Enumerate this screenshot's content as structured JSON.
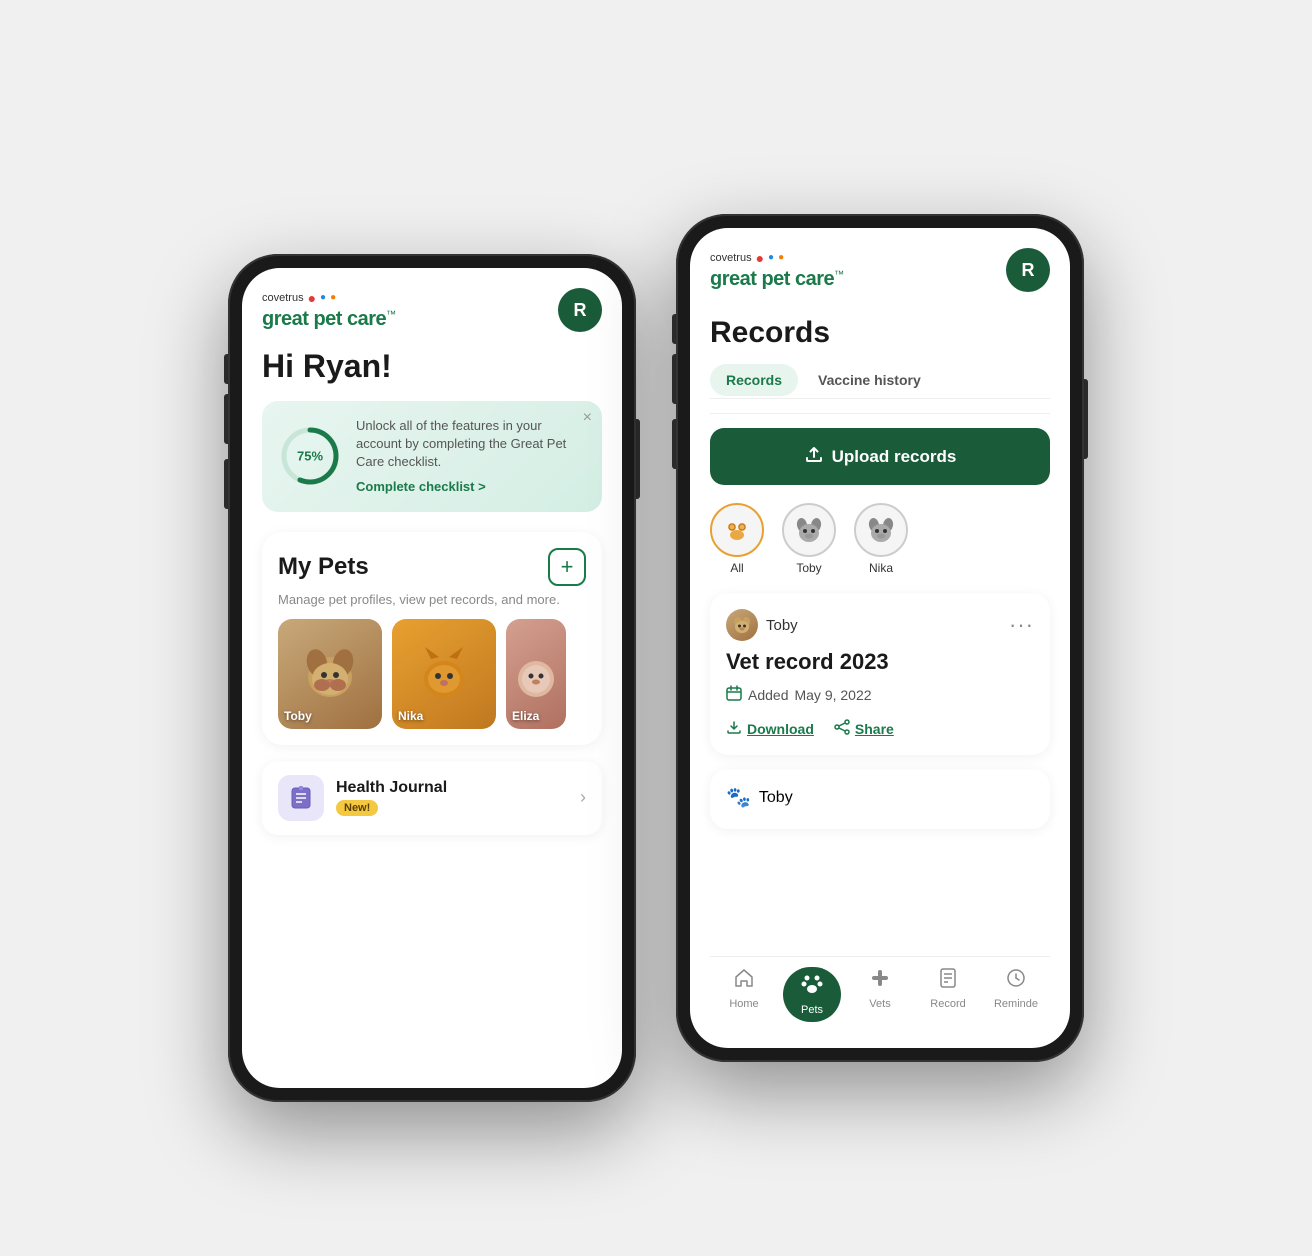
{
  "app": {
    "name": "great pet care",
    "trademark": "™",
    "brand": "covetrus",
    "avatar_letter": "R"
  },
  "phone1": {
    "greeting": "Hi Ryan!",
    "progress": {
      "percent": "75%",
      "percent_num": 75,
      "description": "Unlock all of the features in your account by completing the Great Pet Care checklist.",
      "link_text": "Complete checklist >"
    },
    "my_pets": {
      "title": "My Pets",
      "subtitle": "Manage pet profiles, view pet records, and more.",
      "add_btn": "+",
      "pets": [
        {
          "name": "Toby",
          "type": "dog"
        },
        {
          "name": "Nika",
          "type": "cat"
        },
        {
          "name": "Eliza",
          "type": "other"
        }
      ]
    },
    "health_journal": {
      "title": "Health Journal",
      "badge": "New!"
    }
  },
  "phone2": {
    "title": "Records",
    "tabs": [
      {
        "label": "Records",
        "active": true
      },
      {
        "label": "Vaccine history",
        "active": false
      }
    ],
    "upload_btn": "Upload records",
    "pet_filters": [
      {
        "label": "All",
        "active": true
      },
      {
        "label": "Toby",
        "active": false
      },
      {
        "label": "Nika",
        "active": false
      }
    ],
    "records": [
      {
        "pet_name": "Toby",
        "title": "Vet record 2023",
        "date_label": "Added",
        "date_value": "May 9, 2022",
        "actions": [
          {
            "label": "Download",
            "icon": "↑"
          },
          {
            "label": "Share",
            "icon": "⇢"
          }
        ]
      },
      {
        "pet_name": "Toby",
        "partial": true
      }
    ],
    "bottom_nav": [
      {
        "label": "Home",
        "icon": "⊞",
        "active": false
      },
      {
        "label": "Pets",
        "icon": "🐾",
        "active": true
      },
      {
        "label": "Vets",
        "icon": "✚",
        "active": false
      },
      {
        "label": "Record",
        "icon": "☰",
        "active": false
      },
      {
        "label": "Reminde",
        "icon": "⏱",
        "active": false
      }
    ]
  }
}
